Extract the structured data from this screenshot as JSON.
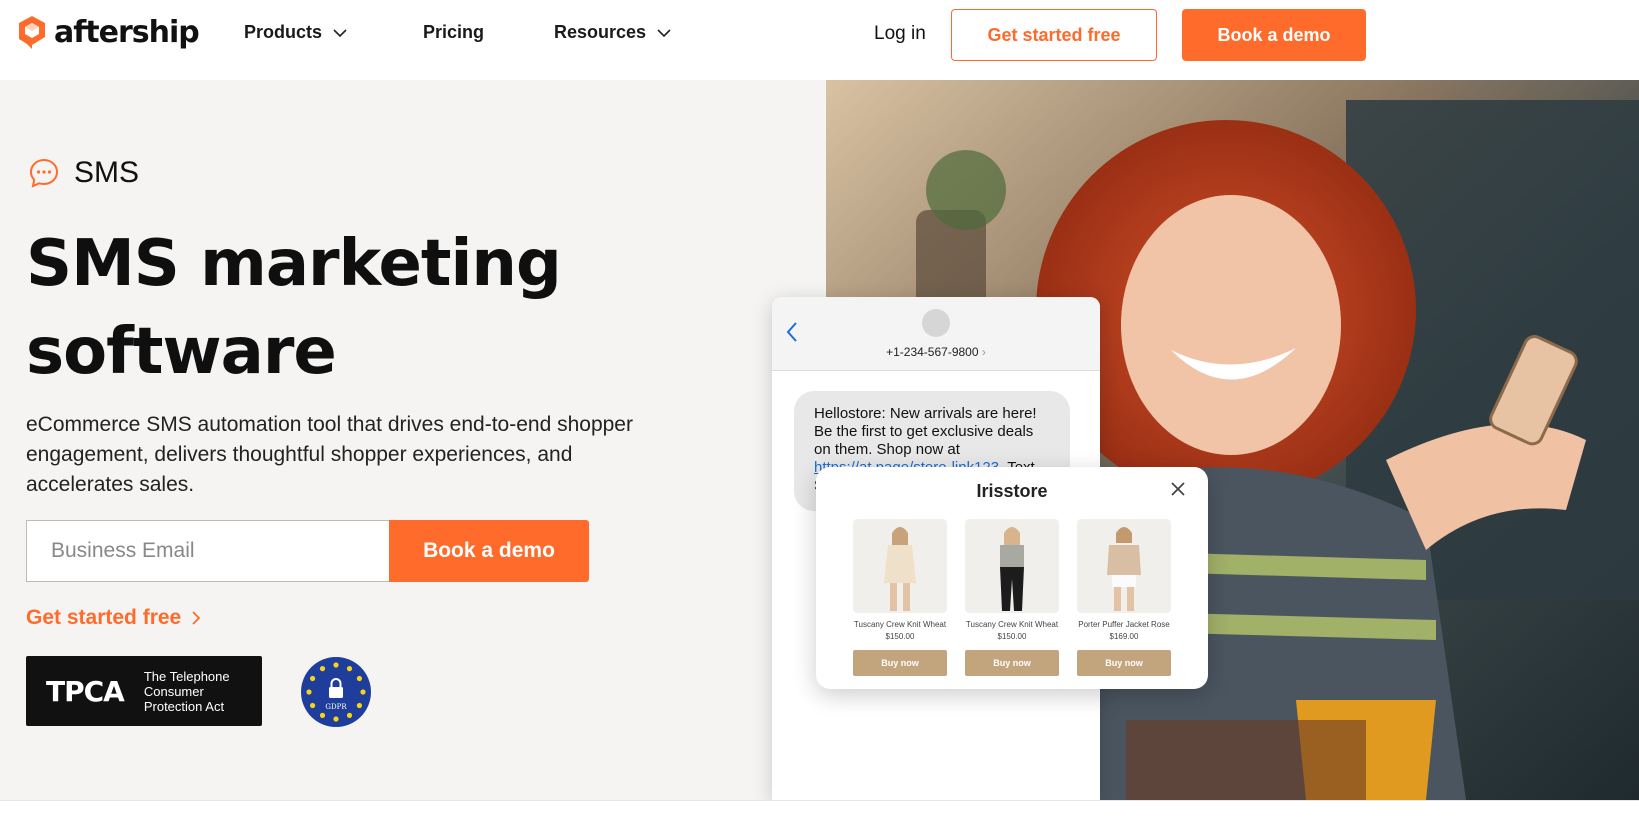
{
  "brand": {
    "name": "aftership",
    "accent": "#ff6b2b"
  },
  "nav": {
    "items": [
      {
        "label": "Products",
        "has_dropdown": true
      },
      {
        "label": "Pricing",
        "has_dropdown": false
      },
      {
        "label": "Resources",
        "has_dropdown": true
      }
    ],
    "login": "Log in",
    "get_started": "Get started free",
    "book_demo": "Book a demo"
  },
  "hero": {
    "tag": "SMS",
    "headline_line1": "SMS marketing",
    "headline_line2": "software",
    "subtitle": "eCommerce SMS automation tool that drives end-to-end shopper engagement, delivers thoughtful shopper experiences, and accelerates sales.",
    "email_placeholder": "Business Email",
    "book_demo": "Book a demo",
    "get_started_link": "Get started free",
    "tpca_abbr": "TPCA",
    "tpca_full": "The Telephone Consumer Protection Act",
    "gdpr_label": "GDPR"
  },
  "phone": {
    "number": "+1-234-567-9800",
    "message_before": "Hellostore: New arrivals are here! Be the first to get exclusive deals on them. Shop now at ",
    "message_link": "https://at.page/store-link123",
    "message_after": ". Text STOP to opt out."
  },
  "store_card": {
    "title": "Irisstore",
    "products": [
      {
        "name": "Tuscany Crew Knit Wheat",
        "price": "$150.00",
        "button": "Buy now"
      },
      {
        "name": "Tuscany Crew Knit Wheat",
        "price": "$150.00",
        "button": "Buy now"
      },
      {
        "name": "Porter Puffer Jacket Rose",
        "price": "$169.00",
        "button": "Buy now"
      }
    ]
  }
}
